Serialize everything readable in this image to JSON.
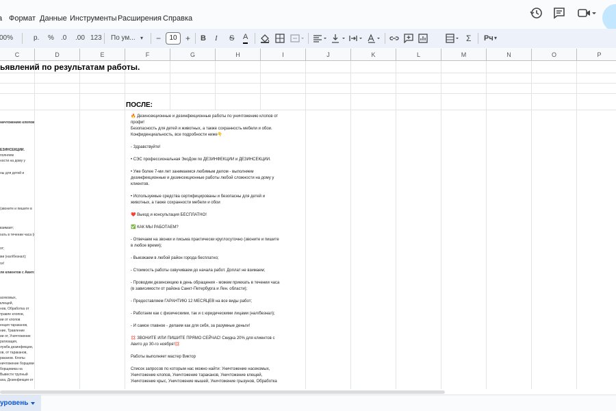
{
  "menu": {
    "items": [
      "Формат",
      "Данные",
      "Инструменты",
      "Расширения",
      "Справка"
    ],
    "partial_first": "а"
  },
  "toolbar": {
    "zoom": "00%",
    "currency": "р.",
    "percent": "%",
    "dec_minus": ".0",
    "dec_plus": ".00",
    "number_format": "123",
    "font": "По ум...",
    "minus": "−",
    "font_size": "10",
    "plus": "+",
    "bold": "B",
    "italic": "I",
    "strike": "S",
    "text_color": "A",
    "sum": "Σ",
    "input_tools": "Рч"
  },
  "columns": [
    "C",
    "D",
    "E",
    "F",
    "G",
    "H",
    "I",
    "J",
    "K",
    "L",
    "M",
    "N",
    "O",
    "P"
  ],
  "sheet": {
    "heading": "ьявлений по результатам работы.",
    "after_label": "ПОСЛЕ:",
    "text_block": [
      "🔥 Дезинсекционные и дезинфекционные работы по уничтожению клопов от профи!\nБезопасность для детей и животных, а также сохранность мебели и обои. Конфиденциальность, все подробности ниже👇",
      "- Здравствуйте!",
      "• СЭС профессиональная ЭкоДом по ДЕЗИНФЕКЦИИ и ДЕЗИНСЕКЦИИ.",
      "• Уже более 7-ми лет занимаемся любимым делом - выполняем дезинфекционные и дезинсекционные работы любой сложности на дому у клиентов.",
      "• Используемые средства сертифицированы и безопасны для детей и животных, а также сохранности мебели и обои",
      "❤️ Выезд и консультация БЕСПЛАТНО!",
      "✅ КАК МЫ РАБОТАЕМ?",
      "- Отвечаем на звонки и письма практически круглосуточно (звоните и пишите в любое время);",
      "- Выезжаем в любой район города бесплатно;",
      "- Стоимость работы озвучиваем до начала работ. Доплат не взимаем;",
      "- Проводим дезинсекцию в день обращения - можем приехать в течении часа (в зависимости от района Санкт-Петербурга и Лен. области);",
      "- Предоставляем ГАРАНТИЮ 12 МЕСЯЦЕВ на все виды работ;",
      "- Работаем как с физическими, так и с юридическими лицами (нал/безнал);",
      "- И самое главное - делаем как для себя, за разумные деньги!",
      "💢 ЗВОНИТЕ ИЛИ ПИШИТЕ ПРЯМО СЕЙЧАС! Скидка 20% для клиентов с Авито до 30-го ноября!💢",
      "Работы выполняет мастер Виктор",
      "Список запросов по которым нас можно найти: Уничтожение насекомых, Уничтожение клопов, Уничтожение тараканов, Уничтожение клещей, Уничтожение крыс, Уничтожение мышей, Уничтожение грызунов, Обработка"
    ],
    "left_fragments": [
      "ничтожению клопов от",
      "ЕЗИНСЕКЦИИ.",
      "полняем",
      "ности на дому у",
      "ны для детей и",
      "(звоните и пишите в",
      "взимает;",
      "хать в течении часа (в",
      "от;",
      "ми (нал/безнал);",
      "ги!",
      "ля клиентов с Авито",
      "асекомых,",
      "клещей,",
      "нов, Обработка от",
      "травле клопов,",
      "ии от клопов",
      "енция тараканов,",
      "ние, Травление",
      "ии от, Уничтожение",
      "ратизация,",
      "лужба дезинфекции,",
      "ов, от тараканов,",
      "раканов. Клопы",
      "ничтожение борщевика,",
      "борщевика на",
      "Вывести трупный",
      "аха, Дезинфекция от"
    ]
  },
  "sheet_tab": {
    "label": "уровень"
  }
}
